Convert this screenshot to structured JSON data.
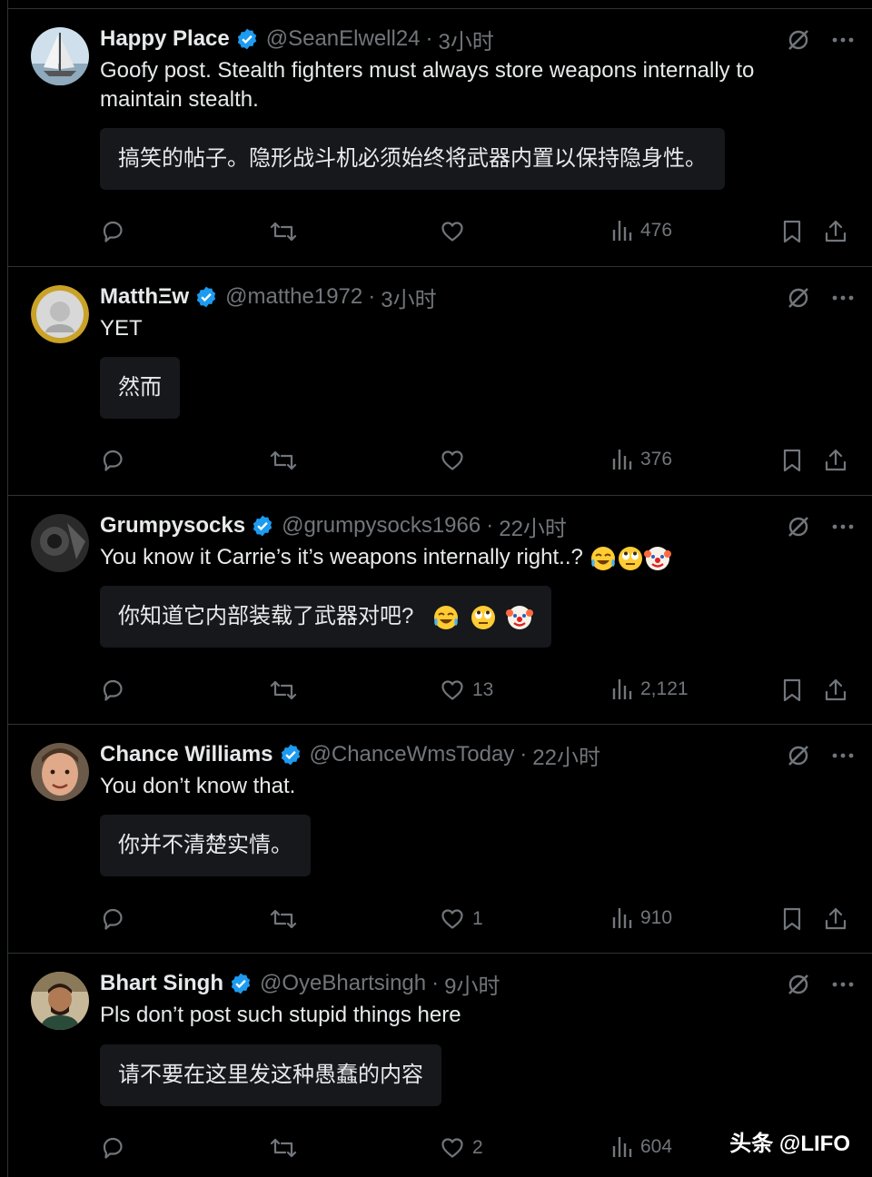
{
  "tweets": [
    {
      "name": "Happy Place",
      "handle": "@SeanElwell24",
      "sep": "·",
      "time": "3小时",
      "text": "Goofy post. Stealth fighters must always store weapons internally to maintain stealth.",
      "translation": "搞笑的帖子。隐形战斗机必须始终将武器内置以保持隐身性。",
      "likes": "",
      "views": "476"
    },
    {
      "name": "MatthΞw",
      "handle": "@matthe1972",
      "sep": "·",
      "time": "3小时",
      "text": "YET",
      "translation": "然而",
      "likes": "",
      "views": "376"
    },
    {
      "name": "Grumpysocks",
      "handle": "@grumpysocks1966",
      "sep": "·",
      "time": "22小时",
      "text": "You know it Carrie’s it’s weapons internally right..?",
      "translation": "你知道它内部装载了武器对吧?",
      "likes": "13",
      "views": "2,121"
    },
    {
      "name": "Chance Williams",
      "handle": "@ChanceWmsToday",
      "sep": "·",
      "time": "22小时",
      "text": "You don’t know that.",
      "translation": "你并不清楚实情。",
      "likes": "1",
      "views": "910"
    },
    {
      "name": "Bhart Singh",
      "handle": "@OyeBhartsingh",
      "sep": "·",
      "time": "9小时",
      "text": "Pls don’t post such stupid things here",
      "translation": "请不要在这里发这种愚蠢的内容",
      "likes": "2",
      "views": "604"
    }
  ],
  "icons": {
    "reply": "reply-icon",
    "repost": "repost-icon",
    "like": "heart-icon",
    "views": "views-chart-icon",
    "bookmark": "bookmark-icon",
    "share": "share-icon",
    "grok": "grok-icon",
    "more": "more-icon",
    "verified": "verified-badge-icon",
    "emoji_tears": "tears-of-joy-emoji",
    "emoji_eyeroll": "eye-roll-emoji",
    "emoji_clown": "clown-emoji"
  },
  "colors": {
    "background": "#000000",
    "text": "#e7e9ea",
    "muted": "#71767b",
    "verified": "#1d9bf0",
    "translation_box": "#16181c"
  },
  "watermark": "头条 @LIFO"
}
